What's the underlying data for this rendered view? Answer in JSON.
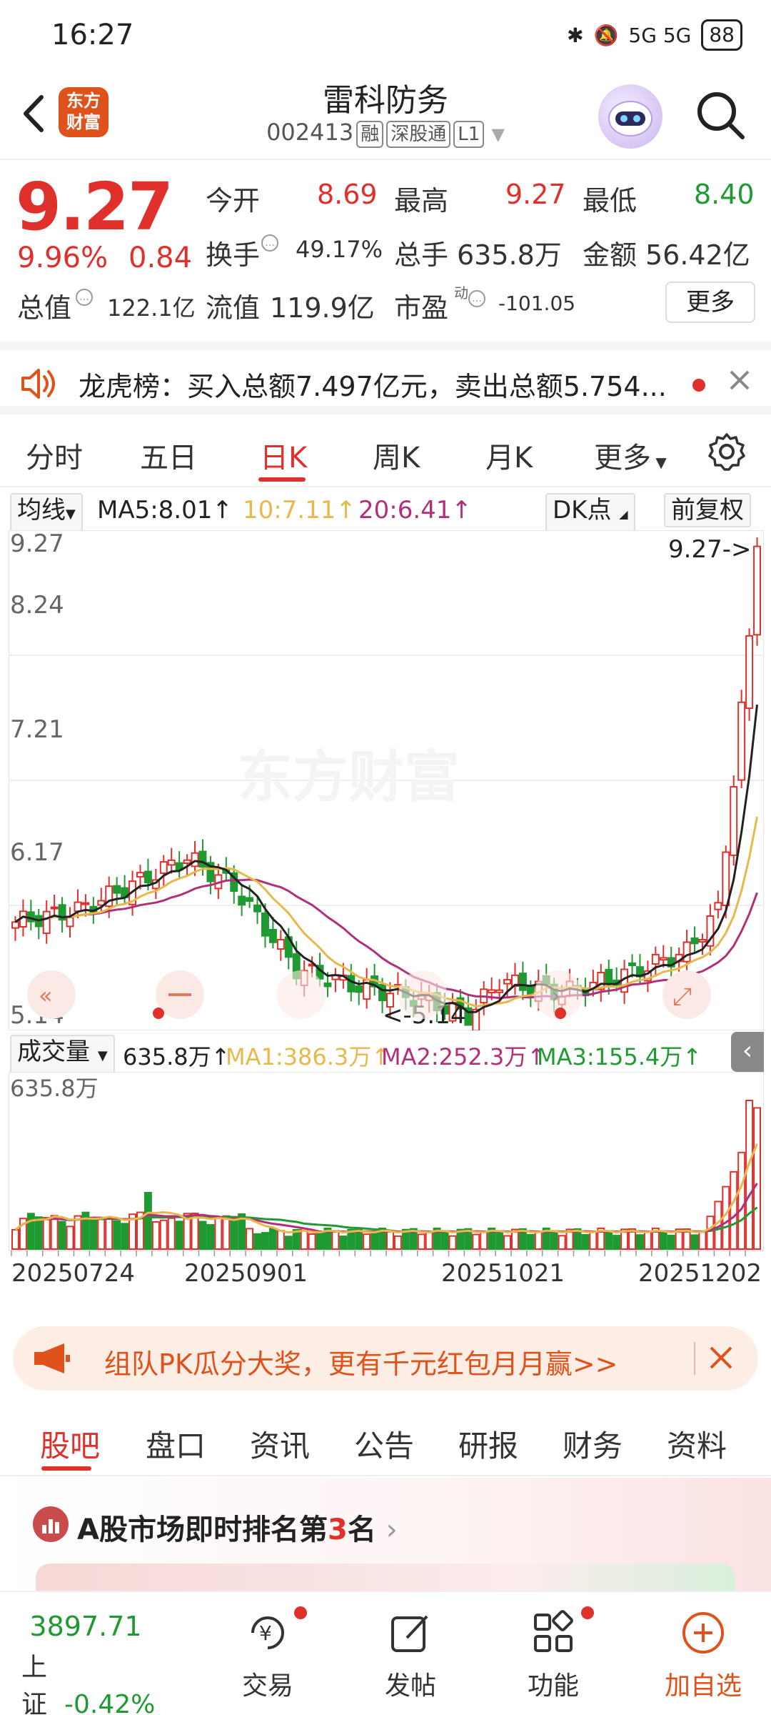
{
  "status_bar": {
    "time": "16:27",
    "network": "5G 5G",
    "battery": "88"
  },
  "header": {
    "logo_text": "东方\n财富",
    "title": "雷科防务",
    "code": "002413",
    "tags": [
      "融",
      "深股通",
      "L1"
    ]
  },
  "quote": {
    "price": "9.27",
    "pct": "9.96%",
    "change": "0.84",
    "open_label": "今开",
    "open": "8.69",
    "high_label": "最高",
    "high": "9.27",
    "low_label": "最低",
    "low": "8.40",
    "turnover_label": "换手",
    "turnover": "49.17%",
    "volume_label": "总手",
    "volume": "635.8万",
    "amount_label": "金额",
    "amount": "56.42亿",
    "mktcap_label": "总值",
    "mktcap": "122.1亿",
    "float_label": "流值",
    "float": "119.9亿",
    "pe_label": "市盈",
    "pe_sup": "动",
    "pe": "-101.05",
    "more_label": "更多"
  },
  "notice": {
    "text": "龙虎榜：买入总额7.497亿元，卖出总额5.754..."
  },
  "ktabs": [
    "分时",
    "五日",
    "日K",
    "周K",
    "月K",
    "更多"
  ],
  "ma_row": {
    "ma_label": "均线",
    "ma5": "MA5:8.01↑",
    "ma10": "10:7.11↑",
    "ma20": "20:6.41↑",
    "dk_label": "DK点",
    "fq_label": "前复权"
  },
  "colors": {
    "up": "#e0302c",
    "down": "#1f9a33",
    "ma5": "#222222",
    "ma10": "#e8b84a",
    "ma20": "#b0307a"
  },
  "chart_data": [
    {
      "type": "candlestick",
      "title": "",
      "y_ticks": [
        "9.27",
        "8.24",
        "7.21",
        "6.17",
        "5.14"
      ],
      "ylim": [
        5.14,
        9.27
      ],
      "annotations": {
        "max": "9.27->",
        "min": "<-5.14"
      },
      "series_legend": [
        "MA5:8.01↑",
        "10:7.11↑",
        "20:6.41↑"
      ]
    },
    {
      "type": "bar",
      "title": "成交量",
      "y_max_label": "635.8万",
      "legend": [
        "635.8万↑",
        "MA1:386.3万↑",
        "MA2:252.3万↑",
        "MA3:155.4万↑"
      ],
      "x_ticks": [
        "20250724",
        "20250901",
        "20251021",
        "20251202"
      ]
    }
  ],
  "volume_row": {
    "label": "成交量",
    "cur": "635.8万↑",
    "ma1": "MA1:386.3万↑",
    "ma2": "MA2:252.3万↑",
    "ma3": "MA3:155.4万↑"
  },
  "promo": {
    "text": "组队PK瓜分大奖，更有千元红包月月赢>>"
  },
  "btabs": [
    "股吧",
    "盘口",
    "资讯",
    "公告",
    "研报",
    "财务",
    "资料"
  ],
  "rank": {
    "prefix": "A股市场即时排名第",
    "num": "3",
    "suffix": "名"
  },
  "nav": {
    "index_value": "3897.71",
    "index_name": "上证",
    "index_pct": "-0.42%",
    "trade": "交易",
    "post": "发帖",
    "func": "功能",
    "add": "加自选"
  },
  "watermark": "东方财富"
}
